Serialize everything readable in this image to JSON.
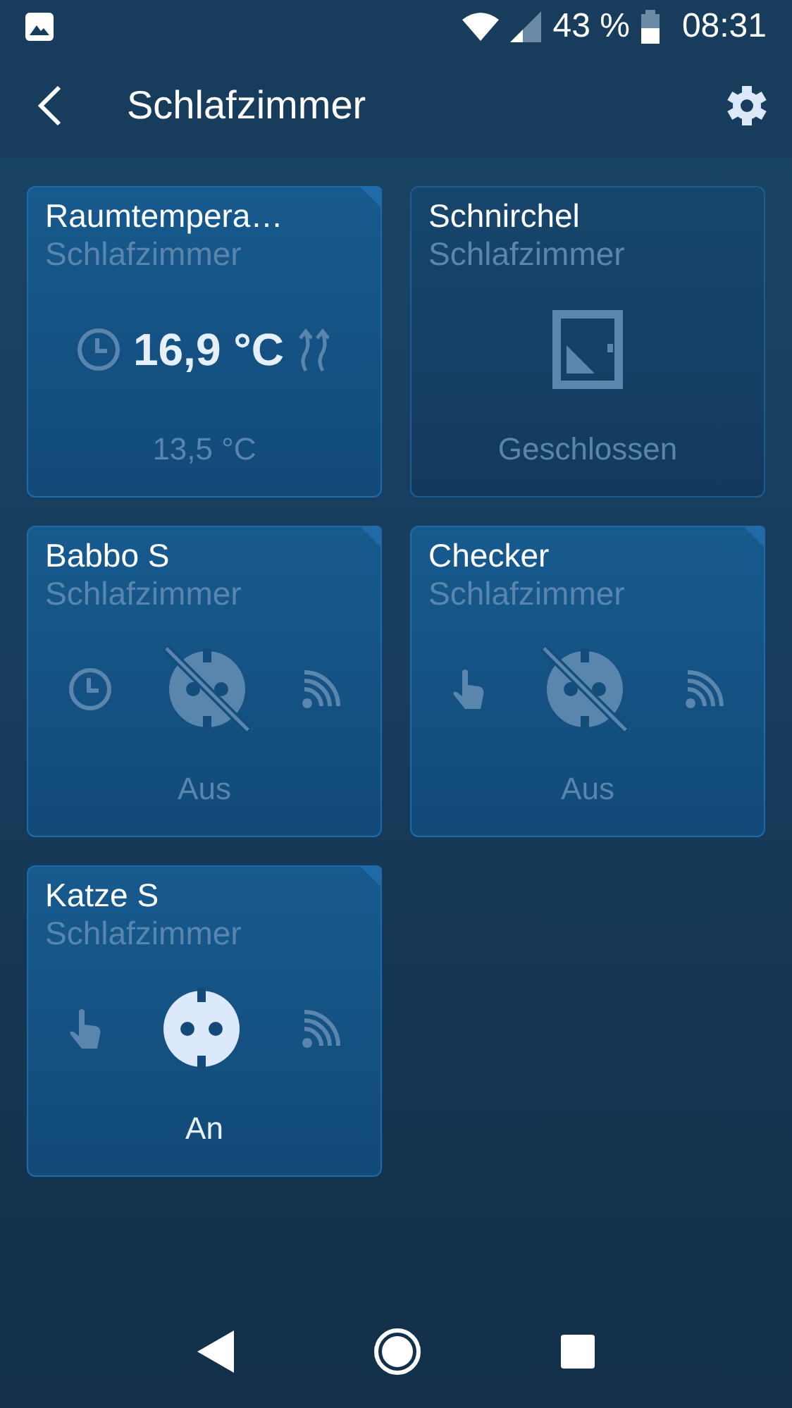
{
  "status_bar": {
    "battery": "43 %",
    "time": "08:31"
  },
  "app_bar": {
    "title": "Schlafzimmer"
  },
  "tiles": [
    {
      "kind": "thermostat",
      "name": "Raumtempera…",
      "room": "Schlafzimmer",
      "marked": true,
      "reading": "16,9 °C",
      "setpoint": "13,5 °C"
    },
    {
      "kind": "door",
      "name": "Schnirchel",
      "room": "Schlafzimmer",
      "marked": false,
      "state": "Geschlossen"
    },
    {
      "kind": "plug",
      "name": "Babbo S",
      "room": "Schlafzimmer",
      "marked": true,
      "scheduled": true,
      "on": false,
      "state": "Aus"
    },
    {
      "kind": "plug",
      "name": "Checker",
      "room": "Schlafzimmer",
      "marked": true,
      "scheduled": false,
      "on": false,
      "state": "Aus"
    },
    {
      "kind": "plug",
      "name": "Katze S",
      "room": "Schlafzimmer",
      "marked": true,
      "scheduled": false,
      "on": true,
      "state": "An"
    }
  ]
}
